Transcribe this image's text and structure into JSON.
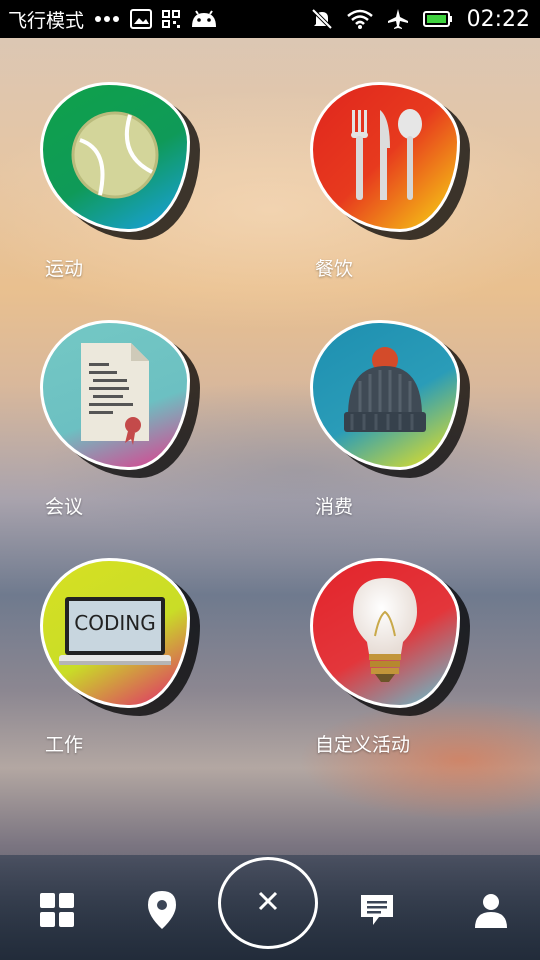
{
  "status_bar": {
    "mode_label": "飞行模式",
    "time": "02:22",
    "icons": [
      "more-dots-icon",
      "image-icon",
      "qr-icon",
      "android-icon",
      "mute-icon",
      "wifi-icon",
      "airplane-icon",
      "battery-icon"
    ]
  },
  "categories": [
    {
      "label": "运动",
      "icon": "tennis-ball-icon",
      "colors": [
        "#0fa14a",
        "#0f9a60",
        "#1aa0e8"
      ]
    },
    {
      "label": "餐饮",
      "icon": "cutlery-icon",
      "colors": [
        "#e0261e",
        "#ef4d1f",
        "#f7d914"
      ]
    },
    {
      "label": "会议",
      "icon": "document-icon",
      "colors": [
        "#74c8c4",
        "#6fc2c2",
        "#e23a8b"
      ]
    },
    {
      "label": "消费",
      "icon": "beanie-hat-icon",
      "colors": [
        "#1e8fb0",
        "#2a9cb8",
        "#f2e51a"
      ]
    },
    {
      "label": "工作",
      "icon": "laptop-coding-icon",
      "colors": [
        "#d7e023",
        "#c9dd27",
        "#e2226f"
      ]
    },
    {
      "label": "自定义活动",
      "icon": "lightbulb-icon",
      "colors": [
        "#e3242b",
        "#e3363b",
        "#5fc6d6"
      ]
    }
  ],
  "laptop_screen_text": "CODING",
  "bottom_nav": {
    "items": [
      "grid-icon",
      "location-pin-icon",
      "close-icon",
      "message-icon",
      "user-icon"
    ]
  }
}
